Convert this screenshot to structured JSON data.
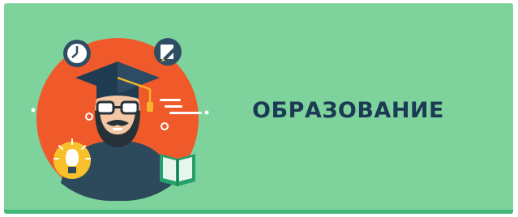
{
  "banner": {
    "title": "ОБРАЗОВАНИЕ",
    "colors": {
      "background": "#7ed39c",
      "bottom_stripe": "#43b67a",
      "title_text": "#1d3a55",
      "orange_circle": "#f05a2a",
      "skin": "#f3c7a4",
      "beard": "#263238",
      "shirt": "#2c4a5c",
      "cap": "#1e3b52",
      "tassel": "#f6b52a",
      "book": "#26a06a",
      "bulb_circle": "#f8c02b",
      "clock": "#2f4e63",
      "accent_white": "#ffffff"
    },
    "icons": [
      "graduate-teacher-icon",
      "clock-icon",
      "pencil-note-icon",
      "lightbulb-icon",
      "open-book-icon"
    ]
  }
}
